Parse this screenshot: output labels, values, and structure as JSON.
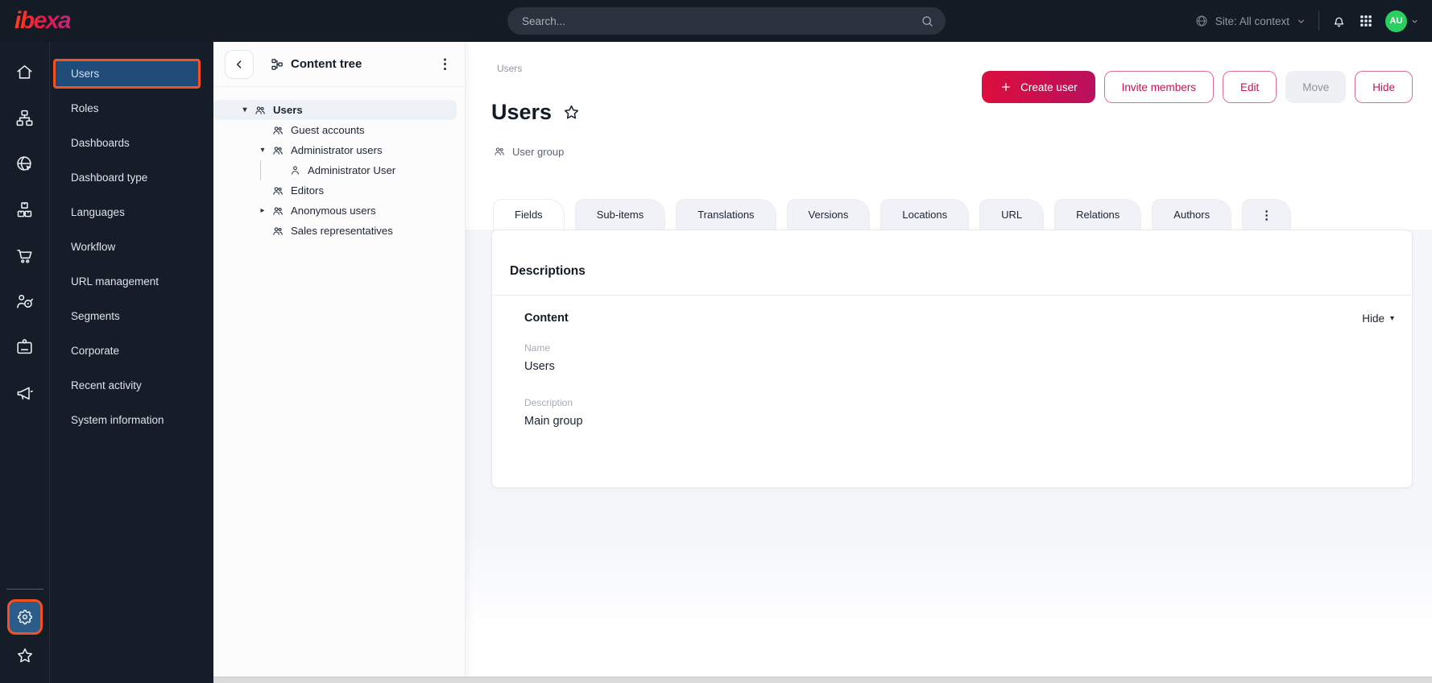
{
  "topbar": {
    "logo": "ibexa",
    "search_placeholder": "Search...",
    "site_context_label": "Site: All context",
    "avatar_initials": "AU"
  },
  "sidebar": {
    "items": [
      {
        "label": "Users",
        "selected": true
      },
      {
        "label": "Roles"
      },
      {
        "label": "Dashboards"
      },
      {
        "label": "Dashboard type"
      },
      {
        "label": "Languages"
      },
      {
        "label": "Workflow"
      },
      {
        "label": "URL management"
      },
      {
        "label": "Segments"
      },
      {
        "label": "Corporate"
      },
      {
        "label": "Recent activity"
      },
      {
        "label": "System information"
      }
    ]
  },
  "content_tree": {
    "title": "Content tree",
    "nodes": [
      {
        "label": "Users",
        "depth": 0,
        "caret": "down",
        "icon": "user-group",
        "selected": true
      },
      {
        "label": "Guest accounts",
        "depth": 1,
        "caret": "none",
        "icon": "user-group"
      },
      {
        "label": "Administrator users",
        "depth": 1,
        "caret": "down",
        "icon": "user-group"
      },
      {
        "label": "Administrator User",
        "depth": 2,
        "caret": "none",
        "icon": "user"
      },
      {
        "label": "Editors",
        "depth": 1,
        "caret": "none",
        "icon": "user-group"
      },
      {
        "label": "Anonymous users",
        "depth": 1,
        "caret": "right",
        "icon": "user-group"
      },
      {
        "label": "Sales representatives",
        "depth": 1,
        "caret": "none",
        "icon": "user-group"
      }
    ]
  },
  "main": {
    "breadcrumb": "Users",
    "title": "Users",
    "content_type": "User group",
    "actions": [
      {
        "label": "Create user",
        "style": "primary"
      },
      {
        "label": "Invite members",
        "style": "outline"
      },
      {
        "label": "Edit",
        "style": "outline"
      },
      {
        "label": "Move",
        "style": "disabled"
      },
      {
        "label": "Hide",
        "style": "outline"
      }
    ],
    "tabs": [
      {
        "label": "Fields",
        "active": true
      },
      {
        "label": "Sub-items"
      },
      {
        "label": "Translations"
      },
      {
        "label": "Versions"
      },
      {
        "label": "Locations"
      },
      {
        "label": "URL"
      },
      {
        "label": "Relations"
      },
      {
        "label": "Authors"
      },
      {
        "label": "⋮",
        "kebab": true
      }
    ],
    "card": {
      "heading": "Descriptions",
      "section": "Content",
      "collapse_label": "Hide",
      "fields": [
        {
          "label": "Name",
          "value": "Users"
        },
        {
          "label": "Description",
          "value": "Main group"
        }
      ]
    }
  },
  "icons": {
    "kebab": "⋮",
    "caret_down": "▾",
    "caret_right": "▸"
  },
  "colors": {
    "topbar_bg": "#131b25",
    "accent_orange": "#f4511e",
    "selected_blue": "#1e4b78",
    "primary_pink": "#c41457",
    "button_gradient_start": "#dc0e3d",
    "button_gradient_end": "#ba105e",
    "avatar_green": "#27d05f"
  }
}
